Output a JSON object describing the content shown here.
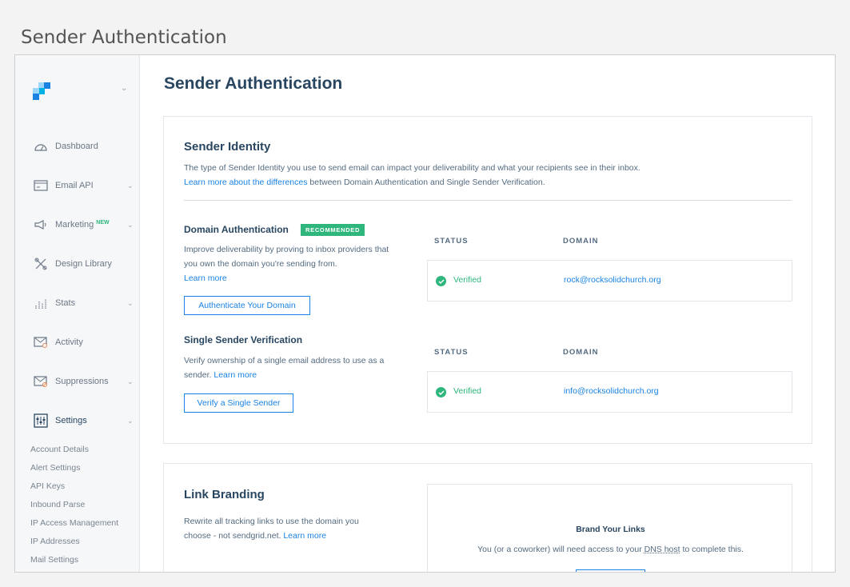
{
  "caption": "Sender Authentication",
  "sidebar": {
    "logo_colors": [
      "#9dd6fb",
      "#1a82e2",
      "#00b2e3",
      "#263746"
    ],
    "items": [
      {
        "label": "Dashboard",
        "icon": "dashboard-icon",
        "has_chevron": false
      },
      {
        "label": "Email API",
        "icon": "email-api-icon",
        "has_chevron": true
      },
      {
        "label": "Marketing",
        "badge": "NEW",
        "icon": "megaphone-icon",
        "has_chevron": true
      },
      {
        "label": "Design Library",
        "icon": "design-library-icon",
        "has_chevron": false
      },
      {
        "label": "Stats",
        "icon": "stats-icon",
        "has_chevron": true
      },
      {
        "label": "Activity",
        "icon": "activity-icon",
        "has_chevron": false
      },
      {
        "label": "Suppressions",
        "icon": "suppressions-icon",
        "has_chevron": true
      },
      {
        "label": "Settings",
        "icon": "settings-icon",
        "has_chevron": true
      }
    ],
    "settings_subitems": [
      "Account Details",
      "Alert Settings",
      "API Keys",
      "Inbound Parse",
      "IP Access Management",
      "IP Addresses",
      "Mail Settings"
    ]
  },
  "main": {
    "title": "Sender Authentication",
    "sender_identity": {
      "heading": "Sender Identity",
      "desc_line1": "The type of Sender Identity you use to send email can impact your deliverability and what your recipients see in their inbox.",
      "desc_link": "Learn more about the differences",
      "desc_line2_rest": " between Domain Authentication and Single Sender Verification."
    },
    "domain_auth": {
      "heading": "Domain Authentication",
      "badge": "RECOMMENDED",
      "desc": "Improve deliverability by proving to inbox providers that you own the domain you're sending from.",
      "learn_more": "Learn more",
      "button": "Authenticate Your Domain",
      "status_header": "STATUS",
      "domain_header": "DOMAIN",
      "status": "Verified",
      "domain": "rock@rocksolidchurch.org"
    },
    "single_sender": {
      "heading": "Single Sender Verification",
      "desc": "Verify ownership of a single email address to use as a sender.",
      "learn_more": "Learn more",
      "button": "Verify a Single Sender",
      "status_header": "STATUS",
      "domain_header": "DOMAIN",
      "status": "Verified",
      "domain": "info@rocksolidchurch.org"
    },
    "link_branding": {
      "heading": "Link Branding",
      "desc": "Rewrite all tracking links to use the domain you choose - not sendgrid.net.",
      "learn_more": "Learn more",
      "box_title": "Brand Your Links",
      "box_desc_pre": "You (or a coworker) will need access to your ",
      "box_desc_link": "DNS host",
      "box_desc_post": " to complete this."
    }
  }
}
